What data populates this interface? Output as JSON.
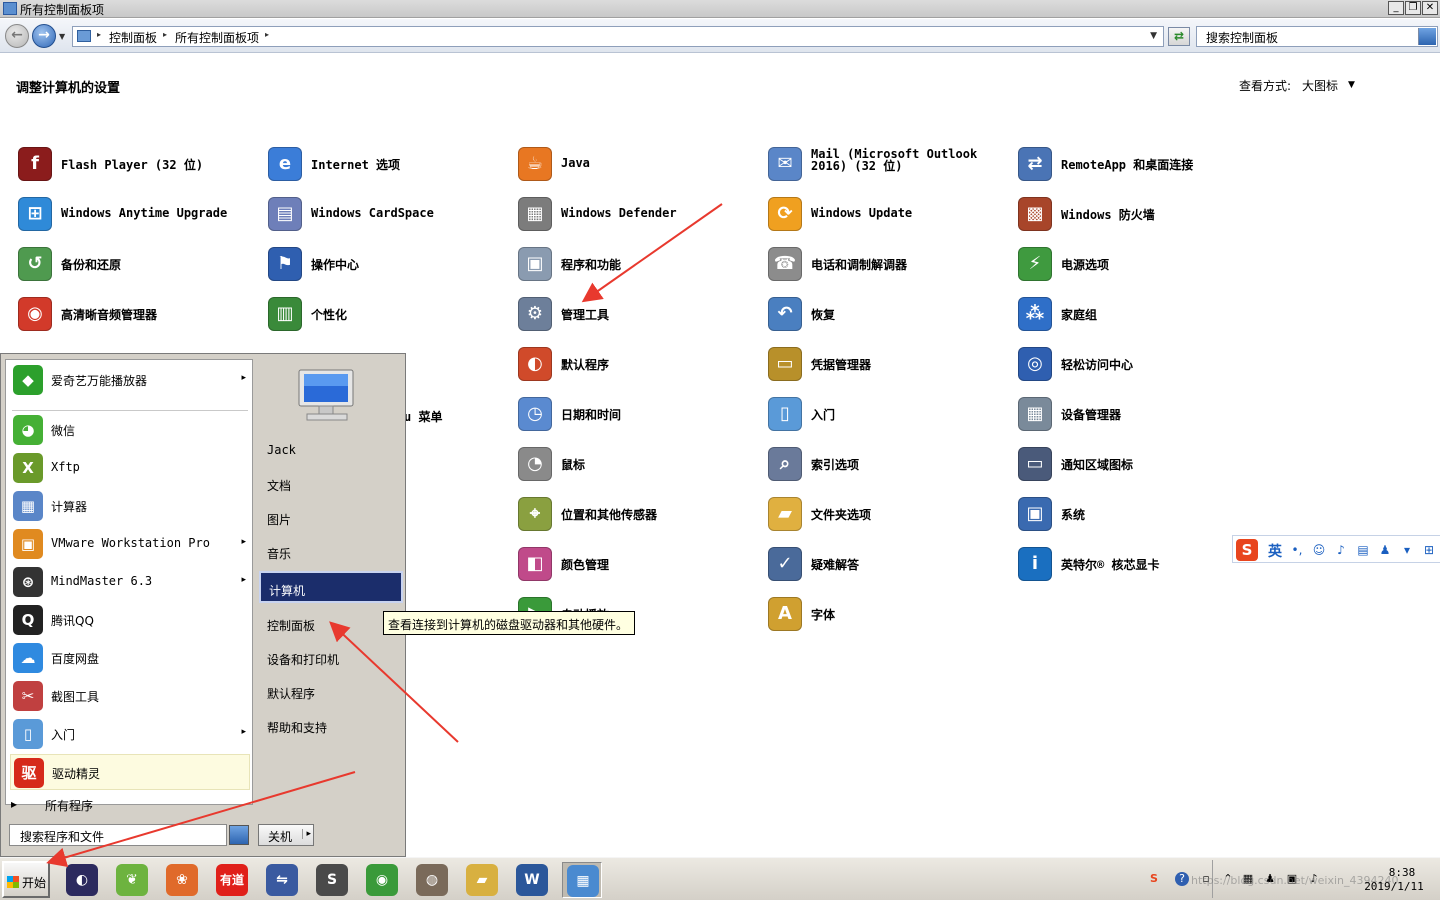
{
  "window": {
    "title": "所有控制面板项",
    "minimize_glyph": "_",
    "restore_glyph": "❐",
    "close_glyph": "✕"
  },
  "address": {
    "crumbs": [
      "控制面板",
      "所有控制面板项"
    ],
    "search_placeholder": "搜索控制面板"
  },
  "content": {
    "heading": "调整计算机的设置",
    "view_by_label": "查看方式:",
    "view_by_value": "大图标"
  },
  "items": [
    {
      "label": "Flash Player (32 位)",
      "icon": "flash-icon",
      "color": "#8b1c1c",
      "glyph": "f"
    },
    {
      "label": "Internet 选项",
      "icon": "internet-options-icon",
      "color": "#3b7dd8",
      "glyph": "e"
    },
    {
      "label": "Java",
      "icon": "java-icon",
      "color": "#e87722",
      "glyph": "☕"
    },
    {
      "label": "Mail (Microsoft Outlook 2016) (32 位)",
      "icon": "mail-icon",
      "color": "#5a86c8",
      "glyph": "✉"
    },
    {
      "label": "RemoteApp 和桌面连接",
      "icon": "remoteapp-icon",
      "color": "#4a74b5",
      "glyph": "⇄"
    },
    {
      "label": "Windows Anytime Upgrade",
      "icon": "windows-upgrade-icon",
      "color": "#2f8ad8",
      "glyph": "⊞"
    },
    {
      "label": "Windows CardSpace",
      "icon": "cardspace-icon",
      "color": "#6e7fb9",
      "glyph": "▤"
    },
    {
      "label": "Windows Defender",
      "icon": "defender-icon",
      "color": "#7c7c7c",
      "glyph": "▦"
    },
    {
      "label": "Windows Update",
      "icon": "windows-update-icon",
      "color": "#f0a020",
      "glyph": "⟳"
    },
    {
      "label": "Windows 防火墙",
      "icon": "firewall-icon",
      "color": "#a8452a",
      "glyph": "▩"
    },
    {
      "label": "备份和还原",
      "icon": "backup-icon",
      "color": "#4f9a4f",
      "glyph": "↺"
    },
    {
      "label": "操作中心",
      "icon": "action-center-icon",
      "color": "#2f5fb0",
      "glyph": "⚑"
    },
    {
      "label": "程序和功能",
      "icon": "programs-icon",
      "color": "#8a9bb0",
      "glyph": "▣"
    },
    {
      "label": "电话和调制解调器",
      "icon": "phone-modem-icon",
      "color": "#8c8c8c",
      "glyph": "☎"
    },
    {
      "label": "电源选项",
      "icon": "power-icon",
      "color": "#3f9a3f",
      "glyph": "⚡"
    },
    {
      "label": "高清晰音频管理器",
      "icon": "audio-manager-icon",
      "color": "#d23a2a",
      "glyph": "◉"
    },
    {
      "label": "个性化",
      "icon": "personalize-icon",
      "color": "#3a8a3a",
      "glyph": "▥"
    },
    {
      "label": "管理工具",
      "icon": "admin-tools-icon",
      "color": "#6d7f9a",
      "glyph": "⚙"
    },
    {
      "label": "恢复",
      "icon": "recovery-icon",
      "color": "#4a7fc0",
      "glyph": "↶"
    },
    {
      "label": "家庭组",
      "icon": "homegroup-icon",
      "color": "#2f6fc8",
      "glyph": "⁂"
    },
    {
      "label": "默认程序",
      "icon": "default-programs-icon",
      "color": "#d04a2a",
      "glyph": "◐"
    },
    {
      "label": "凭据管理器",
      "icon": "credential-icon",
      "color": "#b8902a",
      "glyph": "▭"
    },
    {
      "label": "轻松访问中心",
      "icon": "ease-access-icon",
      "color": "#2f5fb0",
      "glyph": "◎"
    },
    {
      "label": "日期和时间",
      "icon": "datetime-icon",
      "color": "#5a8ad0",
      "glyph": "◷"
    },
    {
      "label": "入门",
      "icon": "getting-started-icon",
      "color": "#5a9ad8",
      "glyph": "▯"
    },
    {
      "label": "设备管理器",
      "icon": "device-manager-icon",
      "color": "#7a8a9a",
      "glyph": "▦"
    },
    {
      "label": "鼠标",
      "icon": "mouse-icon",
      "color": "#8a8a8a",
      "glyph": "◔"
    },
    {
      "label": "索引选项",
      "icon": "indexing-icon",
      "color": "#6a7a9a",
      "glyph": "⌕"
    },
    {
      "label": "通知区域图标",
      "icon": "notification-area-icon",
      "color": "#4a5a7a",
      "glyph": "▭"
    },
    {
      "label": "位置和其他传感器",
      "icon": "sensors-icon",
      "color": "#8aa040",
      "glyph": "⌖"
    },
    {
      "label": "文件夹选项",
      "icon": "folder-options-icon",
      "color": "#e0b040",
      "glyph": "▰"
    },
    {
      "label": "系统",
      "icon": "system-icon",
      "color": "#3a6ab0",
      "glyph": "▣"
    },
    {
      "label": "颜色管理",
      "icon": "color-management-icon",
      "color": "#c04a8a",
      "glyph": "◧"
    },
    {
      "label": "疑难解答",
      "icon": "troubleshoot-icon",
      "color": "#4a6a9a",
      "glyph": "✓"
    },
    {
      "label": "英特尔® 核芯显卡",
      "icon": "intel-graphics-icon",
      "color": "#1a6fc0",
      "glyph": "i"
    },
    {
      "label": "自动播放",
      "icon": "autoplay-icon",
      "color": "#3a9a3a",
      "glyph": "▶"
    },
    {
      "label": "字体",
      "icon": "fonts-icon",
      "color": "#d0a030",
      "glyph": "A"
    }
  ],
  "hidden_fragment": {
    "label": "u 菜单"
  },
  "start_menu": {
    "programs": [
      {
        "label": "爱奇艺万能播放器",
        "icon": "iqiyi-icon",
        "color": "#2ca02c",
        "glyph": "◆",
        "submenu": true
      },
      {
        "label": "微信",
        "icon": "wechat-icon",
        "color": "#45b035",
        "glyph": "◕",
        "submenu": false
      },
      {
        "label": "Xftp",
        "icon": "xftp-icon",
        "color": "#6a9a2a",
        "glyph": "X",
        "submenu": false
      },
      {
        "label": "计算器",
        "icon": "calculator-icon",
        "color": "#5a86c8",
        "glyph": "▦",
        "submenu": false
      },
      {
        "label": "VMware Workstation Pro",
        "icon": "vmware-icon",
        "color": "#e08a20",
        "glyph": "▣",
        "submenu": true
      },
      {
        "label": "MindMaster 6.3",
        "icon": "mindmaster-icon",
        "color": "#333333",
        "glyph": "⊛",
        "submenu": true
      },
      {
        "label": "腾讯QQ",
        "icon": "qq-icon",
        "color": "#222222",
        "glyph": "Q",
        "submenu": false
      },
      {
        "label": "百度网盘",
        "icon": "baidu-netdisk-icon",
        "color": "#2f8ae0",
        "glyph": "☁",
        "submenu": false
      },
      {
        "label": "截图工具",
        "icon": "snipping-tool-icon",
        "color": "#c04040",
        "glyph": "✂",
        "submenu": false
      },
      {
        "label": "入门",
        "icon": "getting-started-icon",
        "color": "#5a9ad8",
        "glyph": "▯",
        "submenu": true
      },
      {
        "label": "驱动精灵",
        "icon": "driver-genius-icon",
        "color": "#d62a1a",
        "glyph": "驱",
        "submenu": false
      }
    ],
    "all_programs": "所有程序",
    "search_placeholder": "搜索程序和文件",
    "shutdown": "关机",
    "places": [
      {
        "label": "Jack",
        "name": "place-user-jack",
        "state": "normal"
      },
      {
        "label": "文档",
        "name": "place-documents",
        "state": "normal"
      },
      {
        "label": "图片",
        "name": "place-pictures",
        "state": "normal"
      },
      {
        "label": "音乐",
        "name": "place-music",
        "state": "normal"
      },
      {
        "label": "计算机",
        "name": "place-computer",
        "state": "active"
      },
      {
        "label": "控制面板",
        "name": "place-control-panel",
        "state": "normal"
      },
      {
        "label": "设备和打印机",
        "name": "place-devices-printers",
        "state": "normal"
      },
      {
        "label": "默认程序",
        "name": "place-default-programs",
        "state": "normal"
      },
      {
        "label": "帮助和支持",
        "name": "place-help-support",
        "state": "normal"
      }
    ]
  },
  "tooltip": "查看连接到计算机的磁盘驱动器和其他硬件。",
  "ime": {
    "lang": "英"
  },
  "taskbar": {
    "start_label": "开始",
    "apps": [
      {
        "name": "eclipse-icon",
        "color": "#2c2a5e",
        "glyph": "◐"
      },
      {
        "name": "spring-tool-icon",
        "color": "#6db33f",
        "glyph": "❦"
      },
      {
        "name": "colorful-app-icon",
        "color": "#e06a2a",
        "glyph": "❀"
      },
      {
        "name": "youdao-icon",
        "color": "#e0201a",
        "glyph": "有道"
      },
      {
        "name": "network-tool-icon",
        "color": "#3a5aa0",
        "glyph": "⇋"
      },
      {
        "name": "sublime-text-icon",
        "color": "#4a4a4a",
        "glyph": "S"
      },
      {
        "name": "chrome-icon",
        "color": "#3a9a3a",
        "glyph": "◉"
      },
      {
        "name": "photo-app-icon",
        "color": "#7a6a5a",
        "glyph": "◍"
      },
      {
        "name": "explorer-icon",
        "color": "#d8b040",
        "glyph": "▰"
      },
      {
        "name": "word-icon",
        "color": "#2b579a",
        "glyph": "W"
      },
      {
        "name": "control-panel-icon",
        "color": "#4a8ad0",
        "glyph": "▦"
      }
    ],
    "clock_time": "8:38",
    "clock_date": "2019/1/11",
    "tray_watermark": "https://blog.csdn.net/weixin_4394240"
  }
}
